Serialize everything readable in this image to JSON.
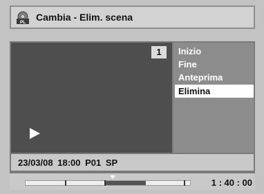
{
  "title_bar": {
    "icon": "pl-icon",
    "icon_text": "PL",
    "title": "Cambia - Elim. scena"
  },
  "preview": {
    "scene_number": "1",
    "play_icon": "play-icon"
  },
  "menu": {
    "items": [
      {
        "label": "Inizio",
        "selected": false
      },
      {
        "label": "Fine",
        "selected": false
      },
      {
        "label": "Anteprima",
        "selected": false
      },
      {
        "label": "Elimina",
        "selected": true
      }
    ]
  },
  "info_bar": {
    "date": "23/03/08",
    "time": "18:00",
    "program": "P01",
    "mode": "SP"
  },
  "timeline": {
    "elapsed": "1 : 40 : 00"
  },
  "colors": {
    "frame": "#c3c3c3",
    "preview_bg": "#4e4e4e",
    "panel": "#8c8c8c",
    "selected_bg": "#ffffff"
  }
}
